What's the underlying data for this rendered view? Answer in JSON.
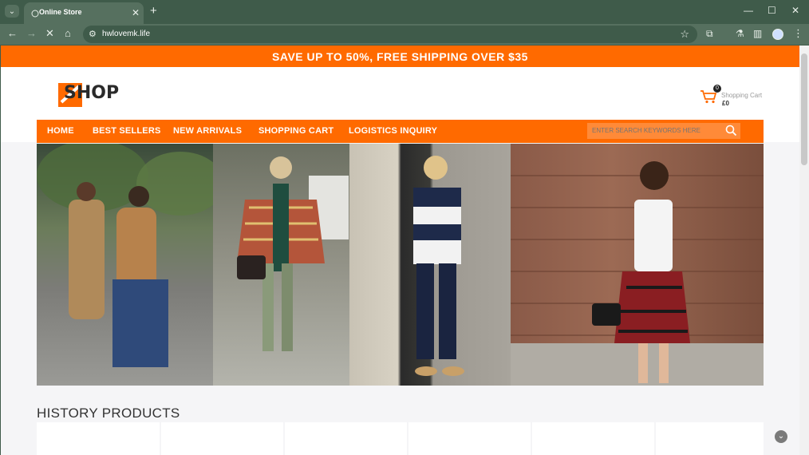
{
  "browser": {
    "tab_title": "Online Store",
    "url": "hwlovemk.life"
  },
  "promo": {
    "text": "SAVE UP TO 50%, FREE SHIPPING OVER $35"
  },
  "logo": {
    "text": "SHOP"
  },
  "cart": {
    "count": "0",
    "label": "Shopping Cart",
    "total": "£0"
  },
  "nav": {
    "items": [
      "HOME",
      "BEST SELLERS",
      "NEW ARRIVALS",
      "SHOPPING CART",
      "LOGISTICS INQUIRY"
    ],
    "search_placeholder": "ENTER SEARCH KEYWORDS HERE"
  },
  "sections": {
    "history_title": "HISTORY PRODUCTS"
  },
  "colors": {
    "accent": "#ff6a00",
    "chrome": "#3f5b4a"
  }
}
